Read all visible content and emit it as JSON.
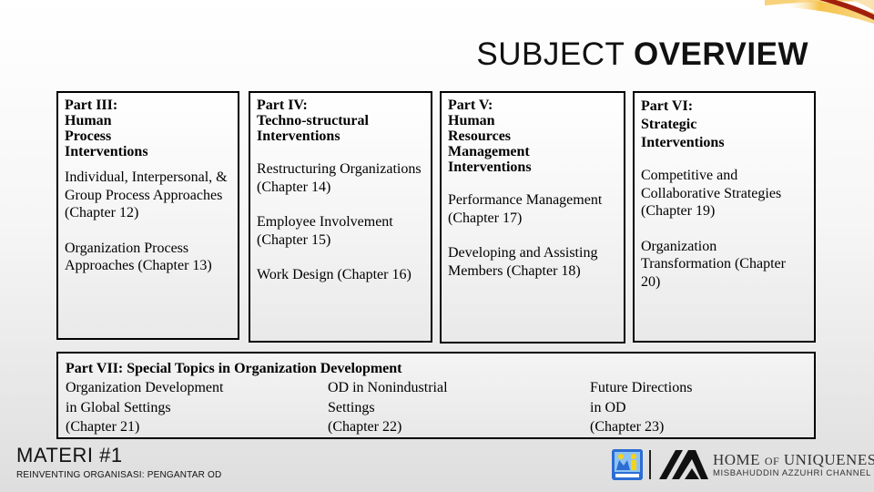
{
  "slide": {
    "title_light": "SUBJECT",
    "title_bold": "OVERVIEW"
  },
  "parts": [
    {
      "heading_lines": [
        "Part III:",
        "Human",
        "Process",
        "Interventions"
      ],
      "items": [
        "Individual, Interpersonal, & Group Process Approaches (Chapter 12)",
        "Organization Process Approaches (Chapter 13)"
      ]
    },
    {
      "heading_lines": [
        "Part IV:",
        "Techno-structural",
        "Interventions"
      ],
      "items": [
        "Restructuring Organizations (Chapter 14)",
        "Employee Involvement (Chapter 15)",
        "Work Design (Chapter 16)"
      ]
    },
    {
      "heading_lines": [
        "Part V:",
        "Human",
        "Resources",
        "Management",
        "Interventions"
      ],
      "items": [
        "Performance Management (Chapter 17)",
        "Developing and Assisting Members (Chapter 18)"
      ]
    },
    {
      "heading_lines": [
        "Part VI:",
        "Strategic",
        "Interventions"
      ],
      "items": [
        "Competitive and Collaborative Strategies (Chapter 19)",
        "Organization Transformation (Chapter 20)"
      ]
    }
  ],
  "part7": {
    "heading": "Part VII: Special Topics in Organization Development",
    "columns": [
      [
        "Organization Development",
        "in Global Settings",
        "(Chapter 21)"
      ],
      [
        "OD in Nonindustrial",
        "Settings",
        "(Chapter 22)"
      ],
      [
        "Future Directions",
        "in OD",
        "(Chapter 23)"
      ]
    ]
  },
  "footer": {
    "materi": "MATERI #1",
    "subtitle": "REINVENTING ORGANISASI: PENGANTAR OD",
    "brand_line1_a": "HOME ",
    "brand_line1_b": "OF",
    "brand_line1_c": " UNIQUENESS",
    "brand_line2": "MISBAHUDDIN AZZUHRI CHANNEL"
  },
  "colors": {
    "accent_dark_red": "#9b1c0c",
    "accent_orange": "#f29a1a",
    "logo_blue": "#2b6dd4",
    "logo_yellow": "#f5d31a"
  }
}
